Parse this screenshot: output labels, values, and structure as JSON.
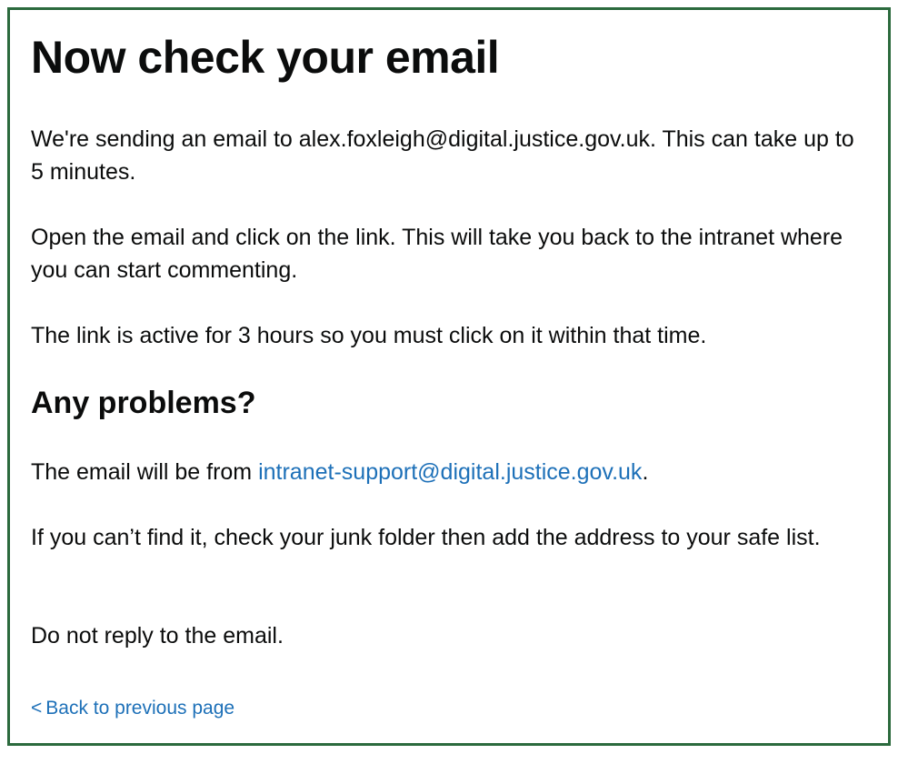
{
  "page": {
    "title": "Now check your email",
    "intro_prefix": "We're sending an email to ",
    "email": "alex.foxleigh@digital.justice.gov.uk",
    "intro_suffix": ". This can take up to 5 minutes.",
    "instructions": "Open the email and click on the link. This will take you back to the intranet where you can start commenting.",
    "expiry": "The link is active for 3 hours so you must click on it within that time."
  },
  "problems": {
    "heading": "Any problems?",
    "from_prefix": "The email will be from ",
    "support_email": "intranet-support@digital.justice.gov.uk",
    "from_suffix": ".",
    "junk_text": "If you can’t find it, check your junk folder then add the address to your safe list.",
    "no_reply": "Do not reply to the email."
  },
  "nav": {
    "back_chevron": "<",
    "back_label": "Back to previous page"
  },
  "colors": {
    "border": "#2b6a3d",
    "link": "#1d70b8",
    "text": "#0b0c0c"
  }
}
